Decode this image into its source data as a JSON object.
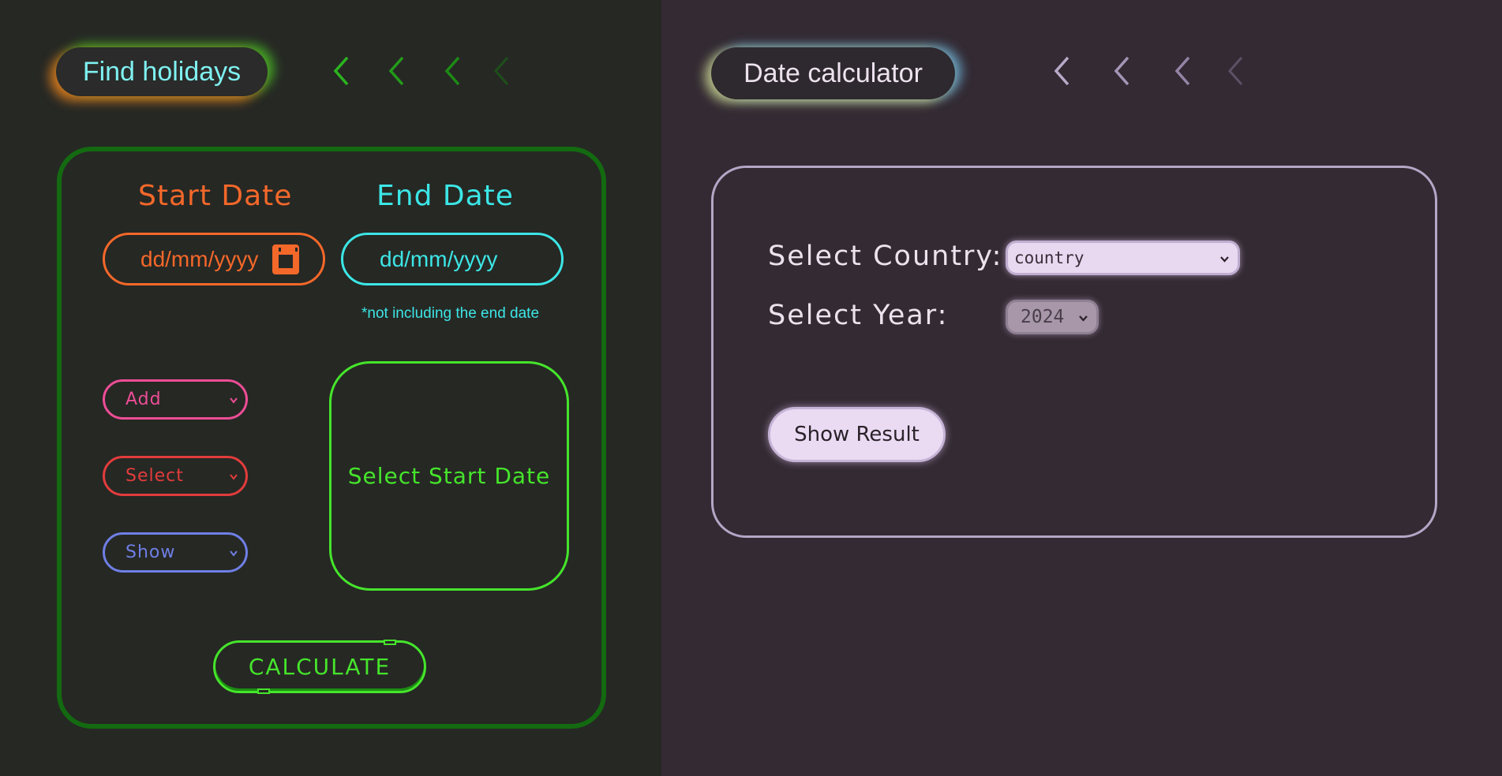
{
  "find_panel": {
    "title_button": "Find holidays",
    "start_label": "Start Date",
    "end_label": "End Date",
    "start_placeholder": "dd/mm/yyyy",
    "end_placeholder": "dd/mm/yyyy",
    "note": "*not including the end date",
    "operation_select": "Add",
    "unit_select": "Select",
    "show_select": "Show",
    "result_text": "Select Start Date",
    "calculate_button": "CALCULATE",
    "colors": {
      "background": "#262824",
      "frame": "#136a10",
      "start": "#f4682a",
      "end": "#3ce6e6",
      "green": "#45e52b",
      "add": "#ee4d96",
      "select": "#e23c3c",
      "show": "#6f7fe6"
    }
  },
  "date_panel": {
    "title_button": "Date calculator",
    "country_label": "Select Country:",
    "country_value": "country",
    "year_label": "Select Year:",
    "year_value": "2024",
    "show_button": "Show Result",
    "colors": {
      "background": "#332a33",
      "frame": "#b4a6c6",
      "text": "#ece2ee"
    }
  },
  "nav_icons": [
    "chevron-left-icon",
    "chevron-left-icon",
    "chevron-left-icon",
    "chevron-left-icon"
  ]
}
